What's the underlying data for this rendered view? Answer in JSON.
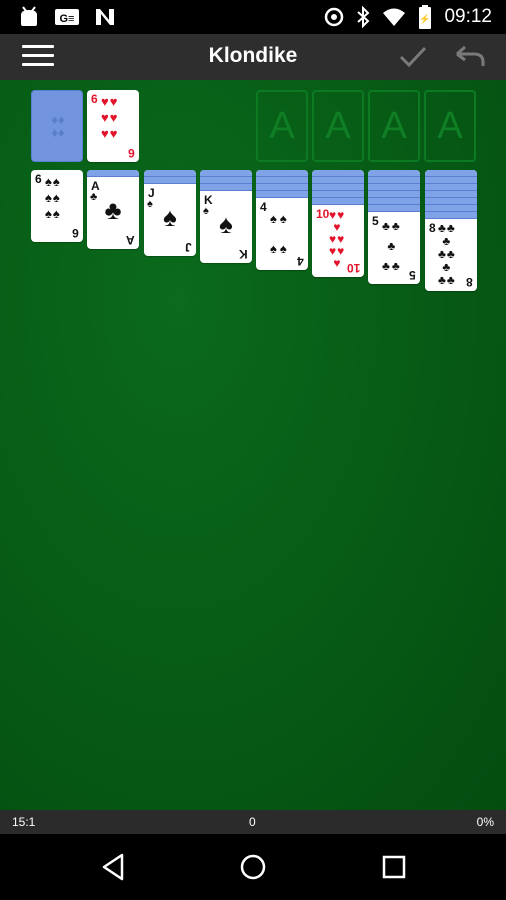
{
  "status_bar": {
    "time": "09:12",
    "icons": [
      "android-icon",
      "g-icon",
      "n-icon",
      "sync-icon",
      "bluetooth-icon",
      "wifi-icon",
      "battery-icon"
    ]
  },
  "app_bar": {
    "title": "Klondike",
    "icons": [
      "menu-icon",
      "check-icon",
      "undo-icon"
    ]
  },
  "stock": {
    "face": "down"
  },
  "waste": {
    "rank": "6",
    "suit": "♥",
    "color": "red"
  },
  "foundations": [
    "A",
    "A",
    "A",
    "A"
  ],
  "tableau": [
    {
      "hidden": 0,
      "rank": "6",
      "suit": "♠",
      "color": "black"
    },
    {
      "hidden": 1,
      "rank": "A",
      "suit": "♣",
      "color": "black"
    },
    {
      "hidden": 2,
      "rank": "J",
      "suit": "♠",
      "color": "black"
    },
    {
      "hidden": 3,
      "rank": "K",
      "suit": "♠",
      "color": "black"
    },
    {
      "hidden": 4,
      "rank": "4",
      "suit": "♠",
      "color": "black"
    },
    {
      "hidden": 5,
      "rank": "10",
      "suit": "♥",
      "color": "red"
    },
    {
      "hidden": 6,
      "rank": "5",
      "suit": "♣",
      "color": "black"
    },
    {
      "hidden": 7,
      "rank": "8",
      "suit": "♣",
      "color": "black"
    }
  ],
  "score_bar": {
    "time": "15:1",
    "score": "0",
    "percent": "0%"
  },
  "nav_bar": {
    "buttons": [
      "back-icon",
      "home-icon",
      "recents-icon"
    ]
  }
}
